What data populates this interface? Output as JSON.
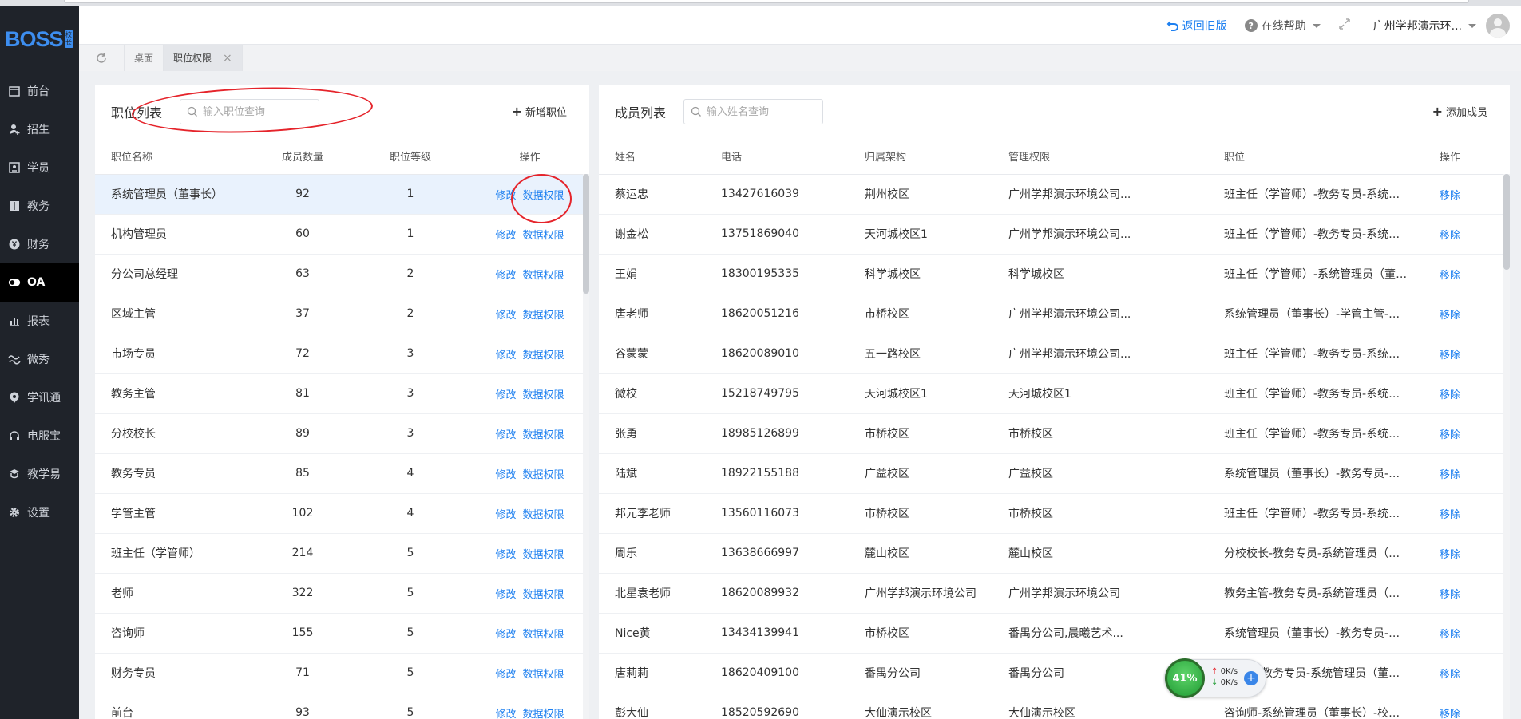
{
  "header": {
    "back_label": "返回旧版",
    "help_label": "在线帮助",
    "user_label": "广州学邦演示环..."
  },
  "sidebar": {
    "logo": "BOSS",
    "logo_badge": "校长",
    "items": [
      {
        "label": "前台",
        "icon": "calendar-icon"
      },
      {
        "label": "招生",
        "icon": "user-add-icon"
      },
      {
        "label": "学员",
        "icon": "id-card-icon"
      },
      {
        "label": "教务",
        "icon": "book-icon"
      },
      {
        "label": "财务",
        "icon": "yen-coin-icon"
      },
      {
        "label": "OA",
        "icon": "toggle-icon",
        "active": true
      },
      {
        "label": "报表",
        "icon": "bar-chart-icon"
      },
      {
        "label": "微秀",
        "icon": "wave-icon"
      },
      {
        "label": "学讯通",
        "icon": "location-icon"
      },
      {
        "label": "电服宝",
        "icon": "headset-icon"
      },
      {
        "label": "教学易",
        "icon": "teach-icon"
      },
      {
        "label": "设置",
        "icon": "gear-icon"
      }
    ]
  },
  "tabs": [
    {
      "label": "桌面",
      "active": false
    },
    {
      "label": "职位权限",
      "active": true,
      "close": "×"
    }
  ],
  "positions": {
    "title": "职位列表",
    "search_placeholder": "输入职位查询",
    "add_label": "新增职位",
    "columns": [
      "职位名称",
      "成员数量",
      "职位等级",
      "操作"
    ],
    "op_edit": "修改",
    "op_data": "数据权限",
    "rows": [
      {
        "name": "系统管理员（董事长）",
        "count": "92",
        "level": "1",
        "selected": true
      },
      {
        "name": "机构管理员",
        "count": "60",
        "level": "1"
      },
      {
        "name": "分公司总经理",
        "count": "63",
        "level": "2"
      },
      {
        "name": "区域主管",
        "count": "37",
        "level": "2"
      },
      {
        "name": "市场专员",
        "count": "72",
        "level": "3"
      },
      {
        "name": "教务主管",
        "count": "81",
        "level": "3"
      },
      {
        "name": "分校校长",
        "count": "89",
        "level": "3"
      },
      {
        "name": "教务专员",
        "count": "85",
        "level": "4"
      },
      {
        "name": "学管主管",
        "count": "102",
        "level": "4"
      },
      {
        "name": "班主任（学管师）",
        "count": "214",
        "level": "5"
      },
      {
        "name": "老师",
        "count": "322",
        "level": "5"
      },
      {
        "name": "咨询师",
        "count": "155",
        "level": "5"
      },
      {
        "name": "财务专员",
        "count": "71",
        "level": "5"
      },
      {
        "name": "前台",
        "count": "93",
        "level": "5"
      }
    ]
  },
  "members": {
    "title": "成员列表",
    "search_placeholder": "输入姓名查询",
    "add_label": "添加成员",
    "columns": [
      "姓名",
      "电话",
      "归属架构",
      "管理权限",
      "职位",
      "操作"
    ],
    "op_remove": "移除",
    "rows": [
      {
        "name": "蔡运忠",
        "phone": "13427616039",
        "org": "荆州校区",
        "perm": "广州学邦演示环境公司...",
        "role": "班主任（学管师）-教务专员-系统管理员（董事长）"
      },
      {
        "name": "谢金松",
        "phone": "13751869040",
        "org": "天河城校区1",
        "perm": "广州学邦演示环境公司...",
        "role": "班主任（学管师）-教务专员-系统管理员（董事长）"
      },
      {
        "name": "王娟",
        "phone": "18300195335",
        "org": "科学城校区",
        "perm": "科学城校区",
        "role": "班主任（学管师）-系统管理员（董事长）"
      },
      {
        "name": "唐老师",
        "phone": "18620051216",
        "org": "市桥校区",
        "perm": "广州学邦演示环境公司...",
        "role": "系统管理员（董事长）-学管主管-分公司总经理"
      },
      {
        "name": "谷蒙蒙",
        "phone": "18620089010",
        "org": "五一路校区",
        "perm": "广州学邦演示环境公司...",
        "role": "班主任（学管师）-教务专员-系统管理员（董事长）"
      },
      {
        "name": "微校",
        "phone": "15218749795",
        "org": "天河城校区1",
        "perm": "天河城校区1",
        "role": "班主任（学管师）-教务专员-系统管理员（董事长）"
      },
      {
        "name": "张勇",
        "phone": "18985126899",
        "org": "市桥校区",
        "perm": "市桥校区",
        "role": "班主任（学管师）-教务专员-系统管理员（董事长）"
      },
      {
        "name": "陆斌",
        "phone": "18922155188",
        "org": "广益校区",
        "perm": "广益校区",
        "role": "系统管理员（董事长）-教务专员-班主任（学管师）"
      },
      {
        "name": "邦元李老师",
        "phone": "13560116073",
        "org": "市桥校区",
        "perm": "市桥校区",
        "role": "班主任（学管师）-教务专员-系统管理员（董事长）"
      },
      {
        "name": "周乐",
        "phone": "13638666997",
        "org": "麓山校区",
        "perm": "麓山校区",
        "role": "分校校长-教务专员-系统管理员（董事长）"
      },
      {
        "name": "北星袁老师",
        "phone": "18620089932",
        "org": "广州学邦演示环境公司",
        "perm": "广州学邦演示环境公司",
        "role": "教务主管-教务专员-系统管理员（董事长）"
      },
      {
        "name": "Nice黄",
        "phone": "13434139941",
        "org": "市桥校区",
        "perm": "番禺分公司,晨曦艺术...",
        "role": "系统管理员（董事长）-教务专员-班主任（学管师）"
      },
      {
        "name": "唐莉莉",
        "phone": "18620409100",
        "org": "番禺分公司",
        "perm": "番禺分公司",
        "role": "班主任-教务专员-系统管理员（董事长）"
      },
      {
        "name": "彭大仙",
        "phone": "18520592690",
        "org": "大仙演示校区",
        "perm": "大仙演示校区",
        "role": "咨询师-系统管理员（董事长）-校区负责人"
      }
    ]
  },
  "net_widget": {
    "percent": "41%",
    "up": "0K/s",
    "down": "0K/s",
    "plus": "+"
  },
  "colors": {
    "accent": "#1e80f0",
    "sidebar_bg": "#1f232a",
    "annotation": "#e5242b",
    "selected_row": "#e9f2fd"
  }
}
